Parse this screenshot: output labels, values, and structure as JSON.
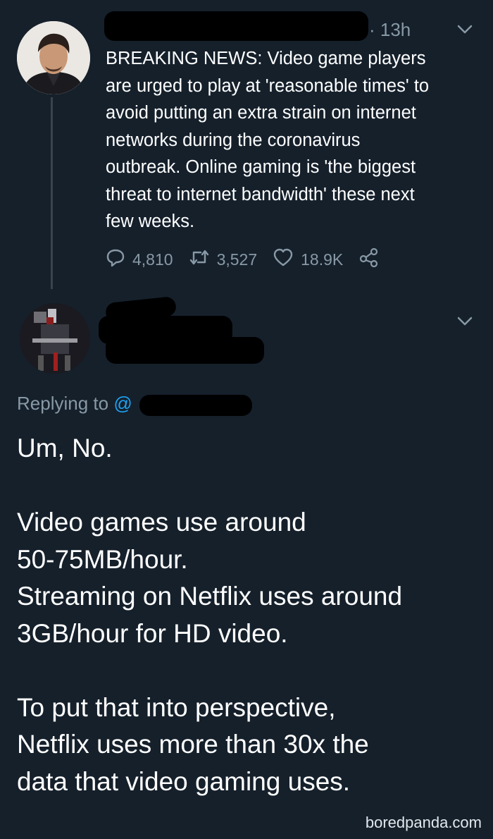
{
  "original_tweet": {
    "time": "· 13h",
    "text": "BREAKING NEWS: Video game players\nare urged to play at 'reasonable times' to\navoid putting an extra strain on internet\nnetworks during the coronavirus\noutbreak. Online gaming is 'the biggest\nthreat to internet bandwidth' these next\nfew weeks.",
    "replies": "4,810",
    "retweets": "3,527",
    "likes": "18.9K"
  },
  "reply_tweet": {
    "replying_to_label": "Replying to",
    "replying_to_handle": "@",
    "text": "Um, No.\n\nVideo games use around\n50-75MB/hour.\nStreaming on Netflix uses around\n3GB/hour for HD video.\n\nTo put that into perspective,\nNetflix uses more than 30x the\ndata that video gaming uses."
  },
  "watermark": "boredpanda.com",
  "colors": {
    "background": "#15202b",
    "secondary_text": "#8899a6",
    "link": "#1da1f2",
    "thread_line": "#38444d"
  },
  "icons": [
    "reply-icon",
    "retweet-icon",
    "like-icon",
    "share-icon",
    "chevron-down-icon"
  ]
}
